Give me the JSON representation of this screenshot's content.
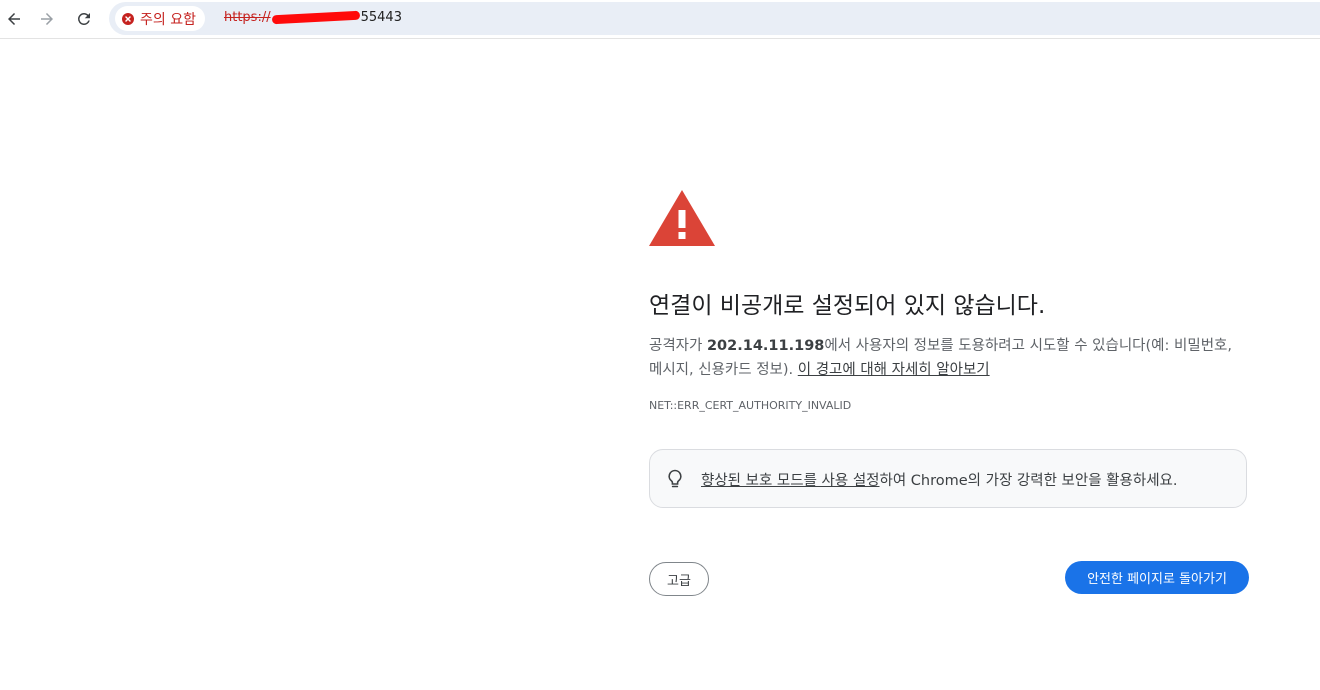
{
  "browser": {
    "security_chip": {
      "icon": "error-circle-icon",
      "label": "주의 요함",
      "color": "#c5221f"
    },
    "url": {
      "scheme": "https://",
      "host_suffix": "55443"
    }
  },
  "interstitial": {
    "icon": "warning-triangle-icon",
    "heading": "연결이 비공개로 설정되어 있지 않습니다.",
    "explanation_before": "공격자가 ",
    "explanation_host": "202.14.11.198",
    "explanation_after": "에서 사용자의 정보를 도용하려고 시도할 수 있습니다(예: 비밀번호, 메시지, 신용카드 정보). ",
    "learn_more": "이 경고에 대해 자세히 알아보기",
    "error_code": "NET::ERR_CERT_AUTHORITY_INVALID",
    "promo": {
      "icon": "lightbulb-icon",
      "link": "향상된 보호 모드를 사용 설정",
      "rest": "하여 Chrome의 가장 강력한 보안을 활용하세요."
    },
    "advanced_label": "고급",
    "back_label": "안전한 페이지로 돌아가기",
    "accent_color": "#1a73e8",
    "warning_color": "#db4437"
  }
}
